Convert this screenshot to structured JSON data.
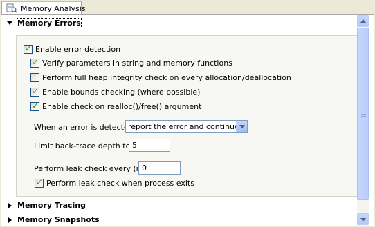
{
  "tab": {
    "label": "Memory Analysis",
    "icon": "memory-analysis-icon"
  },
  "sections": {
    "memory_errors": {
      "label": "Memory Errors",
      "expanded": true,
      "enable_error_detection": {
        "label": "Enable error detection",
        "checked": true
      },
      "verify_parameters": {
        "label": "Verify parameters in string and memory functions",
        "checked": true
      },
      "full_heap_check": {
        "label": "Perform full heap integrity check on every allocation/deallocation",
        "checked": false
      },
      "bounds_checking": {
        "label": "Enable bounds checking (where possible)",
        "checked": true
      },
      "realloc_check": {
        "label": "Enable check on realloc()/free() argument",
        "checked": true
      },
      "when_error": {
        "label": "When an error is detected:",
        "value": "report the error and continue"
      },
      "backtrace_depth": {
        "label": "Limit back-trace depth to:",
        "value": "5"
      },
      "leak_check_every": {
        "label": "Perform leak check every (ms)",
        "value": "0"
      },
      "leak_check_on_exit": {
        "label": "Perform leak check when process exits",
        "checked": true
      }
    },
    "memory_tracing": {
      "label": "Memory Tracing",
      "expanded": false
    },
    "memory_snapshots": {
      "label": "Memory Snapshots",
      "expanded": false
    }
  },
  "colors": {
    "accent_tab": "#f9b94a",
    "check": "#21a121",
    "scrollbar": "#b9cdfb"
  }
}
